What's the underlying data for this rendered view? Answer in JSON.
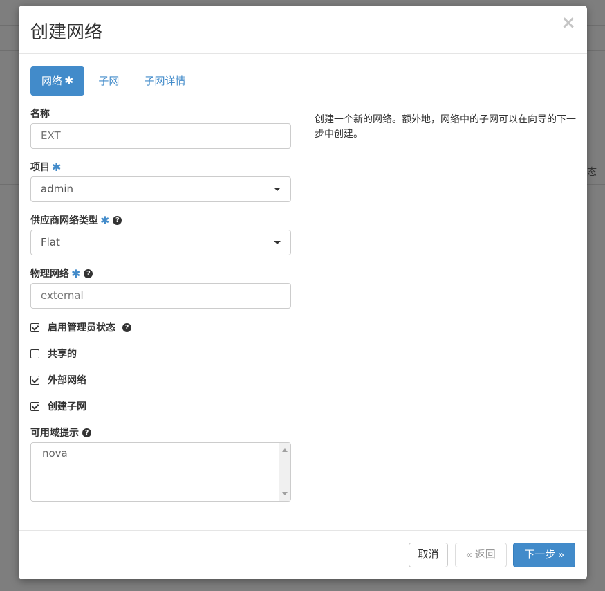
{
  "background": {
    "right_edge_text": "态"
  },
  "modal": {
    "title": "创建网络",
    "close_glyph": "×"
  },
  "tabs": [
    {
      "label": "网络",
      "required": "✱"
    },
    {
      "label": "子网"
    },
    {
      "label": "子网详情"
    }
  ],
  "form": {
    "name": {
      "label": "名称",
      "value": "EXT"
    },
    "project": {
      "label": "项目",
      "required": "✱",
      "value": "admin"
    },
    "provider_network_type": {
      "label": "供应商网络类型",
      "required": "✱",
      "help": "?",
      "value": "Flat"
    },
    "physical_network": {
      "label": "物理网络",
      "required": "✱",
      "help": "?",
      "value": "external"
    },
    "admin_state": {
      "label": "启用管理员状态",
      "help": "?",
      "checked": true
    },
    "shared": {
      "label": "共享的",
      "checked": false
    },
    "external_network": {
      "label": "外部网络",
      "checked": true
    },
    "create_subnet": {
      "label": "创建子网",
      "checked": true
    },
    "az_hints": {
      "label": "可用域提示",
      "help": "?",
      "value": "nova"
    }
  },
  "description": "创建一个新的网络。额外地，网络中的子网可以在向导的下一步中创建。",
  "footer": {
    "cancel_label": "取消",
    "back_label": "« 返回",
    "next_label": "下一步 »"
  },
  "colors": {
    "accent": "#428bca",
    "overlay": "#7e7e7e"
  }
}
